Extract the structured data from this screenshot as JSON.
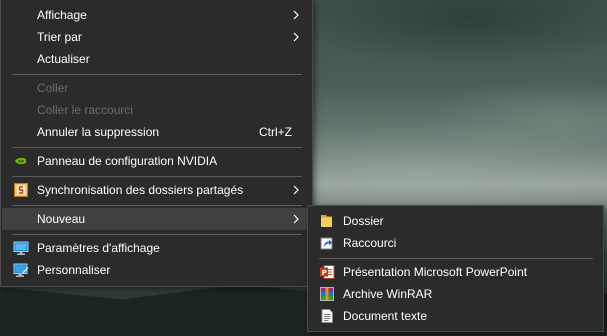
{
  "context_menu": {
    "items": [
      {
        "label": "Affichage"
      },
      {
        "label": "Trier par"
      },
      {
        "label": "Actualiser"
      },
      {
        "label": "Coller"
      },
      {
        "label": "Coller le raccourci"
      },
      {
        "label": "Annuler la suppression",
        "shortcut": "Ctrl+Z"
      },
      {
        "label": "Panneau de configuration NVIDIA",
        "icon": "nvidia-icon"
      },
      {
        "label": "Synchronisation des dossiers partagés",
        "icon": "sync-folder-icon"
      },
      {
        "label": "Nouveau"
      },
      {
        "label": "Paramètres d'affichage",
        "icon": "display-settings-icon"
      },
      {
        "label": "Personnaliser",
        "icon": "personalize-icon"
      }
    ]
  },
  "submenu_nouveau": {
    "items": [
      {
        "label": "Dossier",
        "icon": "folder-icon"
      },
      {
        "label": "Raccourci",
        "icon": "shortcut-icon"
      },
      {
        "label": "Présentation Microsoft PowerPoint",
        "icon": "powerpoint-icon"
      },
      {
        "label": "Archive WinRAR",
        "icon": "winrar-icon"
      },
      {
        "label": "Document texte",
        "icon": "text-document-icon"
      }
    ]
  },
  "colors": {
    "menu_background": "#2b2b2b",
    "menu_highlight": "#414141",
    "disabled_text": "#6d6d6d",
    "separator": "#5a5a5a"
  }
}
